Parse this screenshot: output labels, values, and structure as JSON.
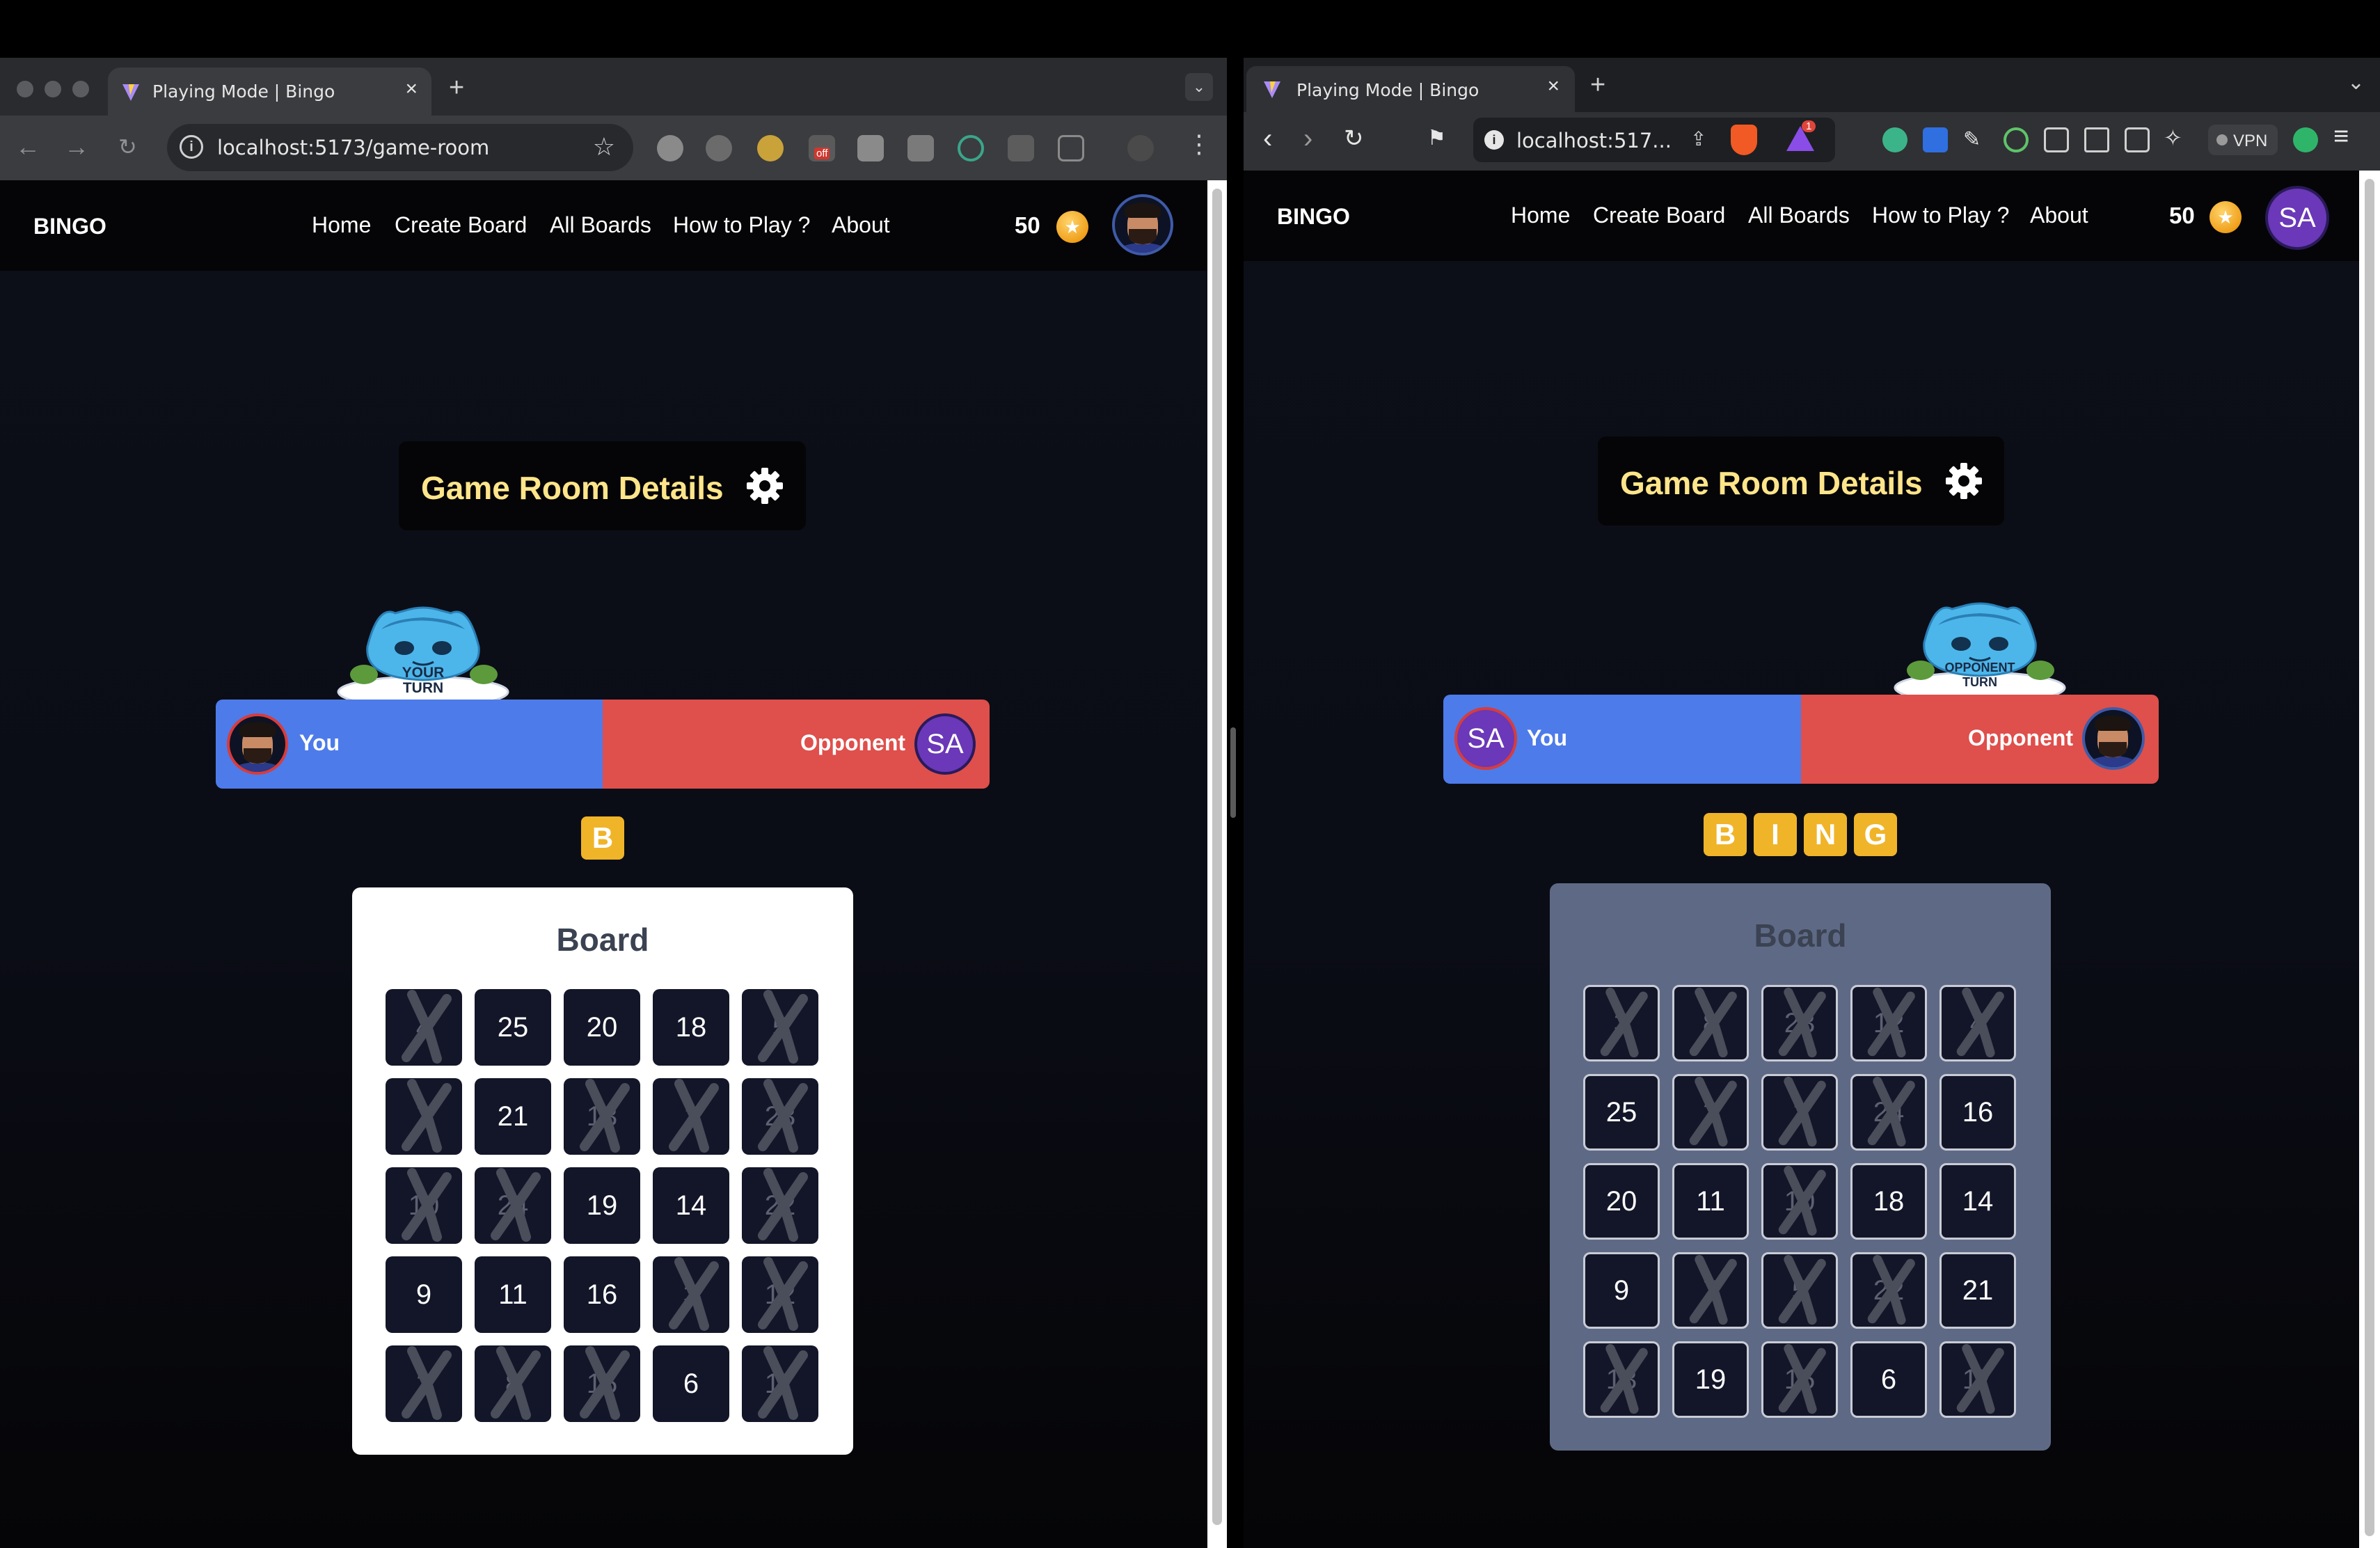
{
  "left_browser": {
    "tab_title": "Playing Mode | Bingo",
    "url": "localhost:5173/game-room",
    "ext_badge": "off"
  },
  "right_browser": {
    "tab_title": "Playing Mode | Bingo",
    "url": "localhost:517...",
    "vpn_label": "VPN",
    "notif_count": "1"
  },
  "nav": {
    "brand": "BINGO",
    "links": [
      "Home",
      "Create Board",
      "All Boards",
      "How to Play ?",
      "About"
    ],
    "coins": "50",
    "avatar_initials": "SA"
  },
  "game": {
    "details_title": "Game Room Details",
    "you_label": "You",
    "opponent_label": "Opponent",
    "board_title": "Board",
    "your_turn_text": [
      "YOUR",
      "TURN"
    ],
    "opponent_turn_text": [
      "OPPONENT",
      "TURN"
    ]
  },
  "left_player": {
    "letters": [
      "B"
    ],
    "board": [
      [
        {
          "n": "4",
          "m": true
        },
        {
          "n": "25",
          "m": false
        },
        {
          "n": "20",
          "m": false
        },
        {
          "n": "18",
          "m": false
        },
        {
          "n": "5",
          "m": true
        }
      ],
      [
        {
          "n": "7",
          "m": true
        },
        {
          "n": "21",
          "m": false
        },
        {
          "n": "13",
          "m": true
        },
        {
          "n": "1",
          "m": true
        },
        {
          "n": "23",
          "m": true
        }
      ],
      [
        {
          "n": "10",
          "m": true
        },
        {
          "n": "24",
          "m": true
        },
        {
          "n": "19",
          "m": false
        },
        {
          "n": "14",
          "m": false
        },
        {
          "n": "22",
          "m": true
        }
      ],
      [
        {
          "n": "9",
          "m": false
        },
        {
          "n": "11",
          "m": false
        },
        {
          "n": "16",
          "m": false
        },
        {
          "n": "3",
          "m": true
        },
        {
          "n": "12",
          "m": true
        }
      ],
      [
        {
          "n": "2",
          "m": true
        },
        {
          "n": "8",
          "m": true
        },
        {
          "n": "15",
          "m": true
        },
        {
          "n": "6",
          "m": false
        },
        {
          "n": "17",
          "m": true
        }
      ]
    ]
  },
  "right_player": {
    "letters": [
      "B",
      "I",
      "N",
      "G"
    ],
    "board": [
      [
        {
          "n": "3",
          "m": true
        },
        {
          "n": "8",
          "m": true
        },
        {
          "n": "23",
          "m": true
        },
        {
          "n": "12",
          "m": true
        },
        {
          "n": "4",
          "m": true
        }
      ],
      [
        {
          "n": "25",
          "m": false
        },
        {
          "n": "2",
          "m": true
        },
        {
          "n": "1",
          "m": true
        },
        {
          "n": "24",
          "m": true
        },
        {
          "n": "16",
          "m": false
        }
      ],
      [
        {
          "n": "20",
          "m": false
        },
        {
          "n": "11",
          "m": false
        },
        {
          "n": "10",
          "m": true
        },
        {
          "n": "18",
          "m": false
        },
        {
          "n": "14",
          "m": false
        }
      ],
      [
        {
          "n": "9",
          "m": false
        },
        {
          "n": "7",
          "m": true
        },
        {
          "n": "5",
          "m": true
        },
        {
          "n": "22",
          "m": true
        },
        {
          "n": "21",
          "m": false
        }
      ],
      [
        {
          "n": "13",
          "m": true
        },
        {
          "n": "19",
          "m": false
        },
        {
          "n": "15",
          "m": true
        },
        {
          "n": "6",
          "m": false
        },
        {
          "n": "17",
          "m": true
        }
      ]
    ]
  },
  "colors": {
    "accent_yellow": "#f0b429",
    "you_blue": "#4d7bea",
    "opponent_red": "#df4f4b",
    "details_text": "#ffe58a",
    "cell_bg": "#131628",
    "board_left_bg": "#ffffff",
    "board_right_bg": "#5e6a85"
  }
}
